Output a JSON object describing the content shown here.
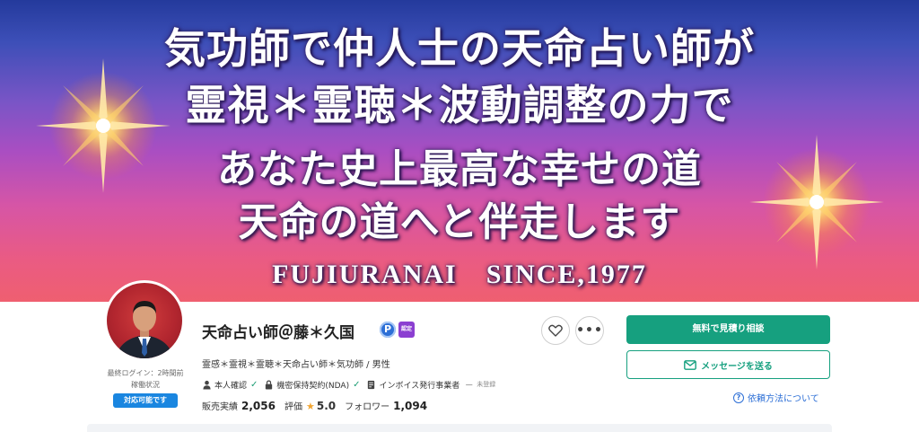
{
  "banner": {
    "line1": "気功師で仲人士の天命占い師が",
    "line2": "霊視＊霊聴＊波動調整の力で",
    "line3": "あなた史上最高な幸せの道",
    "line4": "天命の道へと伴走します",
    "line5": "FUJIURANAI　SINCE,1977"
  },
  "profile": {
    "name": "天命占い師＠藤＊久国",
    "badge_p": "P",
    "badge_cert": "認定",
    "tagline": "霊感＊霊視＊霊聴＊天命占い師＊気功師 / 男性",
    "last_login": "最終ログイン：2時間前",
    "status_label": "稼働状況",
    "status_badge": "対応可能です"
  },
  "verification": {
    "identity": "本人確認",
    "nda": "機密保持契約(NDA)",
    "invoice": "インボイス発行事業者",
    "invoice_dash": "ー",
    "invoice_status": "未登録"
  },
  "stats": {
    "sales_label": "販売実績",
    "sales_value": "2,056",
    "rating_label": "評価",
    "rating_value": "5.0",
    "followers_label": "フォロワー",
    "followers_value": "1,094"
  },
  "actions": {
    "quote_button": "無料で見積り相談",
    "message_button": "メッセージを送る",
    "howto_link": "依頼方法について",
    "more_glyph": "•••"
  },
  "colors": {
    "accent": "#16a07f",
    "link": "#2d6fd6",
    "status_badge": "#1a86e0",
    "star": "#f2a531"
  }
}
